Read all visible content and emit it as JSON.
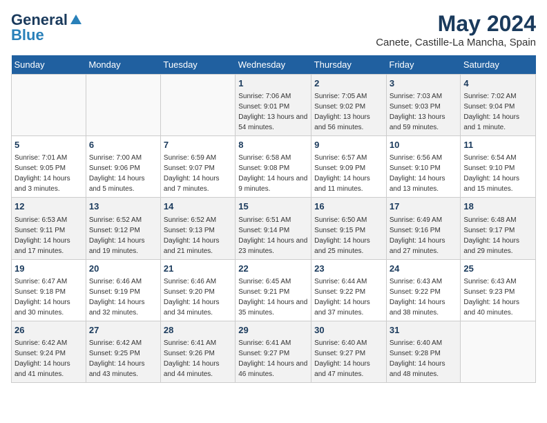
{
  "header": {
    "logo_general": "General",
    "logo_blue": "Blue",
    "month_year": "May 2024",
    "location": "Canete, Castille-La Mancha, Spain"
  },
  "weekdays": [
    "Sunday",
    "Monday",
    "Tuesday",
    "Wednesday",
    "Thursday",
    "Friday",
    "Saturday"
  ],
  "weeks": [
    [
      {
        "day": "",
        "sunrise": "",
        "sunset": "",
        "daylight": ""
      },
      {
        "day": "",
        "sunrise": "",
        "sunset": "",
        "daylight": ""
      },
      {
        "day": "",
        "sunrise": "",
        "sunset": "",
        "daylight": ""
      },
      {
        "day": "1",
        "sunrise": "Sunrise: 7:06 AM",
        "sunset": "Sunset: 9:01 PM",
        "daylight": "Daylight: 13 hours and 54 minutes."
      },
      {
        "day": "2",
        "sunrise": "Sunrise: 7:05 AM",
        "sunset": "Sunset: 9:02 PM",
        "daylight": "Daylight: 13 hours and 56 minutes."
      },
      {
        "day": "3",
        "sunrise": "Sunrise: 7:03 AM",
        "sunset": "Sunset: 9:03 PM",
        "daylight": "Daylight: 13 hours and 59 minutes."
      },
      {
        "day": "4",
        "sunrise": "Sunrise: 7:02 AM",
        "sunset": "Sunset: 9:04 PM",
        "daylight": "Daylight: 14 hours and 1 minute."
      }
    ],
    [
      {
        "day": "5",
        "sunrise": "Sunrise: 7:01 AM",
        "sunset": "Sunset: 9:05 PM",
        "daylight": "Daylight: 14 hours and 3 minutes."
      },
      {
        "day": "6",
        "sunrise": "Sunrise: 7:00 AM",
        "sunset": "Sunset: 9:06 PM",
        "daylight": "Daylight: 14 hours and 5 minutes."
      },
      {
        "day": "7",
        "sunrise": "Sunrise: 6:59 AM",
        "sunset": "Sunset: 9:07 PM",
        "daylight": "Daylight: 14 hours and 7 minutes."
      },
      {
        "day": "8",
        "sunrise": "Sunrise: 6:58 AM",
        "sunset": "Sunset: 9:08 PM",
        "daylight": "Daylight: 14 hours and 9 minutes."
      },
      {
        "day": "9",
        "sunrise": "Sunrise: 6:57 AM",
        "sunset": "Sunset: 9:09 PM",
        "daylight": "Daylight: 14 hours and 11 minutes."
      },
      {
        "day": "10",
        "sunrise": "Sunrise: 6:56 AM",
        "sunset": "Sunset: 9:10 PM",
        "daylight": "Daylight: 14 hours and 13 minutes."
      },
      {
        "day": "11",
        "sunrise": "Sunrise: 6:54 AM",
        "sunset": "Sunset: 9:10 PM",
        "daylight": "Daylight: 14 hours and 15 minutes."
      }
    ],
    [
      {
        "day": "12",
        "sunrise": "Sunrise: 6:53 AM",
        "sunset": "Sunset: 9:11 PM",
        "daylight": "Daylight: 14 hours and 17 minutes."
      },
      {
        "day": "13",
        "sunrise": "Sunrise: 6:52 AM",
        "sunset": "Sunset: 9:12 PM",
        "daylight": "Daylight: 14 hours and 19 minutes."
      },
      {
        "day": "14",
        "sunrise": "Sunrise: 6:52 AM",
        "sunset": "Sunset: 9:13 PM",
        "daylight": "Daylight: 14 hours and 21 minutes."
      },
      {
        "day": "15",
        "sunrise": "Sunrise: 6:51 AM",
        "sunset": "Sunset: 9:14 PM",
        "daylight": "Daylight: 14 hours and 23 minutes."
      },
      {
        "day": "16",
        "sunrise": "Sunrise: 6:50 AM",
        "sunset": "Sunset: 9:15 PM",
        "daylight": "Daylight: 14 hours and 25 minutes."
      },
      {
        "day": "17",
        "sunrise": "Sunrise: 6:49 AM",
        "sunset": "Sunset: 9:16 PM",
        "daylight": "Daylight: 14 hours and 27 minutes."
      },
      {
        "day": "18",
        "sunrise": "Sunrise: 6:48 AM",
        "sunset": "Sunset: 9:17 PM",
        "daylight": "Daylight: 14 hours and 29 minutes."
      }
    ],
    [
      {
        "day": "19",
        "sunrise": "Sunrise: 6:47 AM",
        "sunset": "Sunset: 9:18 PM",
        "daylight": "Daylight: 14 hours and 30 minutes."
      },
      {
        "day": "20",
        "sunrise": "Sunrise: 6:46 AM",
        "sunset": "Sunset: 9:19 PM",
        "daylight": "Daylight: 14 hours and 32 minutes."
      },
      {
        "day": "21",
        "sunrise": "Sunrise: 6:46 AM",
        "sunset": "Sunset: 9:20 PM",
        "daylight": "Daylight: 14 hours and 34 minutes."
      },
      {
        "day": "22",
        "sunrise": "Sunrise: 6:45 AM",
        "sunset": "Sunset: 9:21 PM",
        "daylight": "Daylight: 14 hours and 35 minutes."
      },
      {
        "day": "23",
        "sunrise": "Sunrise: 6:44 AM",
        "sunset": "Sunset: 9:22 PM",
        "daylight": "Daylight: 14 hours and 37 minutes."
      },
      {
        "day": "24",
        "sunrise": "Sunrise: 6:43 AM",
        "sunset": "Sunset: 9:22 PM",
        "daylight": "Daylight: 14 hours and 38 minutes."
      },
      {
        "day": "25",
        "sunrise": "Sunrise: 6:43 AM",
        "sunset": "Sunset: 9:23 PM",
        "daylight": "Daylight: 14 hours and 40 minutes."
      }
    ],
    [
      {
        "day": "26",
        "sunrise": "Sunrise: 6:42 AM",
        "sunset": "Sunset: 9:24 PM",
        "daylight": "Daylight: 14 hours and 41 minutes."
      },
      {
        "day": "27",
        "sunrise": "Sunrise: 6:42 AM",
        "sunset": "Sunset: 9:25 PM",
        "daylight": "Daylight: 14 hours and 43 minutes."
      },
      {
        "day": "28",
        "sunrise": "Sunrise: 6:41 AM",
        "sunset": "Sunset: 9:26 PM",
        "daylight": "Daylight: 14 hours and 44 minutes."
      },
      {
        "day": "29",
        "sunrise": "Sunrise: 6:41 AM",
        "sunset": "Sunset: 9:27 PM",
        "daylight": "Daylight: 14 hours and 46 minutes."
      },
      {
        "day": "30",
        "sunrise": "Sunrise: 6:40 AM",
        "sunset": "Sunset: 9:27 PM",
        "daylight": "Daylight: 14 hours and 47 minutes."
      },
      {
        "day": "31",
        "sunrise": "Sunrise: 6:40 AM",
        "sunset": "Sunset: 9:28 PM",
        "daylight": "Daylight: 14 hours and 48 minutes."
      },
      {
        "day": "",
        "sunrise": "",
        "sunset": "",
        "daylight": ""
      }
    ]
  ]
}
